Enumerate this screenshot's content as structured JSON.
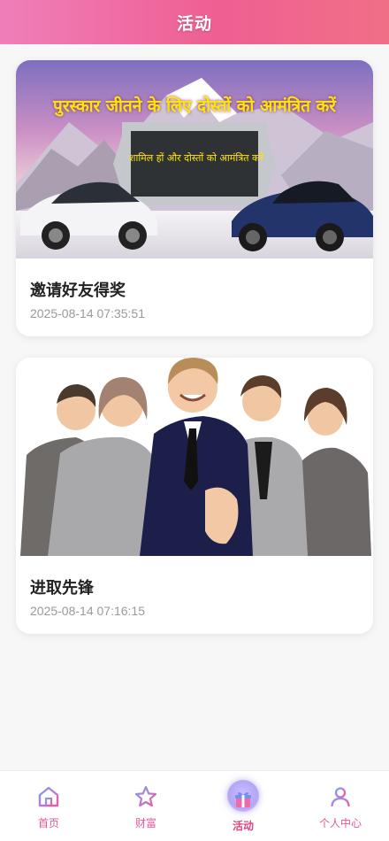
{
  "header": {
    "title": "活动"
  },
  "activities": [
    {
      "title": "邀请好友得奖",
      "date": "2025-08-14 07:35:51",
      "banner_headline": "पुरस्कार जीतने के लिए दोस्तों को आमंत्रित करें",
      "banner_sub": "शामिल हों और दोस्तों को आमंत्रित करें"
    },
    {
      "title": "进取先锋",
      "date": "2025-08-14 07:16:15"
    }
  ],
  "tabbar": {
    "items": [
      {
        "label": "首页",
        "icon": "home-icon"
      },
      {
        "label": "财富",
        "icon": "star-icon"
      },
      {
        "label": "活动",
        "icon": "gift-icon",
        "active": true
      },
      {
        "label": "个人中心",
        "icon": "user-icon"
      }
    ]
  },
  "colors": {
    "accent": "#e2569a",
    "header_start": "#ef7fb9",
    "header_end": "#f06f86"
  }
}
